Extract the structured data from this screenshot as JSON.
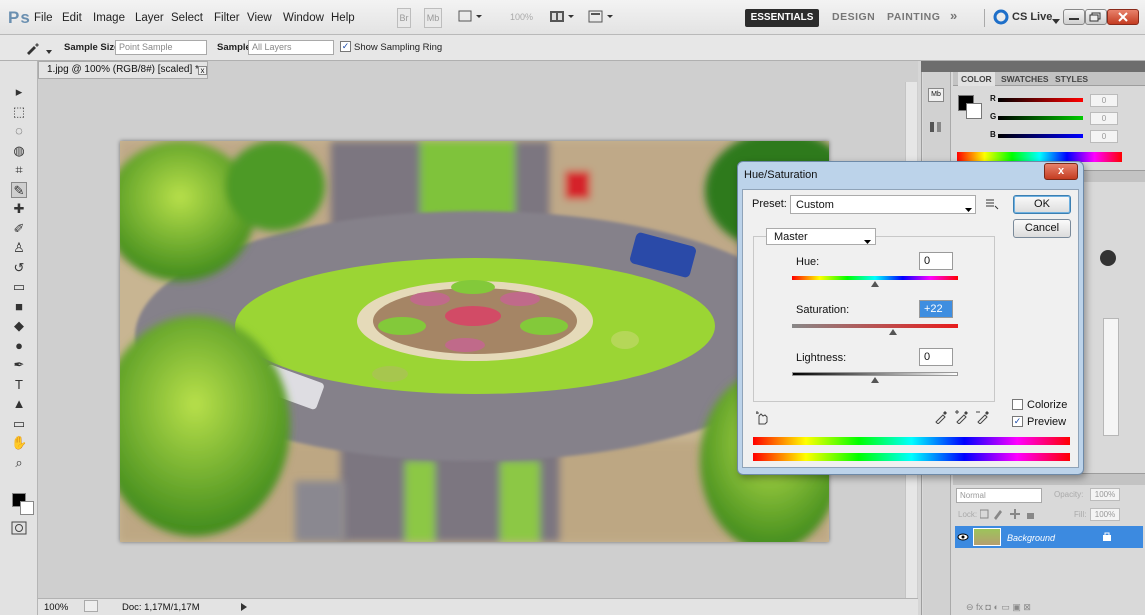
{
  "app": {
    "logo": "Ps"
  },
  "menubar": {
    "items": [
      "File",
      "Edit",
      "Image",
      "Layer",
      "Select",
      "Filter",
      "View",
      "Window",
      "Help"
    ],
    "zoom_display": "100%",
    "workspaces": {
      "essentials": "ESSENTIALS",
      "design": "DESIGN",
      "painting": "PAINTING",
      "more": "»"
    },
    "cslive": "CS Live"
  },
  "options": {
    "sample_size_label": "Sample Size:",
    "sample_size_value": "Point Sample",
    "sample_label": "Sample:",
    "sample_value": "All Layers",
    "show_ring_label": "Show Sampling Ring"
  },
  "document": {
    "tab_title": "1.jpg @ 100% (RGB/8#) [scaled] *"
  },
  "status": {
    "zoom": "100%",
    "doc": "Doc: 1,17M/1,17M"
  },
  "color_panel": {
    "tabs": [
      "COLOR",
      "SWATCHES",
      "STYLES"
    ],
    "r_label": "R",
    "g_label": "G",
    "b_label": "B",
    "r_value": "0",
    "g_value": "0",
    "b_value": "0"
  },
  "layers_panel": {
    "blend_mode": "Normal",
    "opacity_label": "Opacity:",
    "opacity_value": "100%",
    "lock_label": "Lock:",
    "fill_label": "Fill:",
    "fill_value": "100%",
    "layer_name": "Background"
  },
  "dialog": {
    "title": "Hue/Saturation",
    "preset_label": "Preset:",
    "preset_value": "Custom",
    "channel": "Master",
    "hue_label": "Hue:",
    "hue_value": "0",
    "saturation_label": "Saturation:",
    "saturation_value": "+22",
    "lightness_label": "Lightness:",
    "lightness_value": "0",
    "ok_label": "OK",
    "cancel_label": "Cancel",
    "colorize_label": "Colorize",
    "preview_label": "Preview",
    "close_glyph": "x",
    "hue_position": 0.5,
    "saturation_position": 0.61,
    "lightness_position": 0.5
  }
}
